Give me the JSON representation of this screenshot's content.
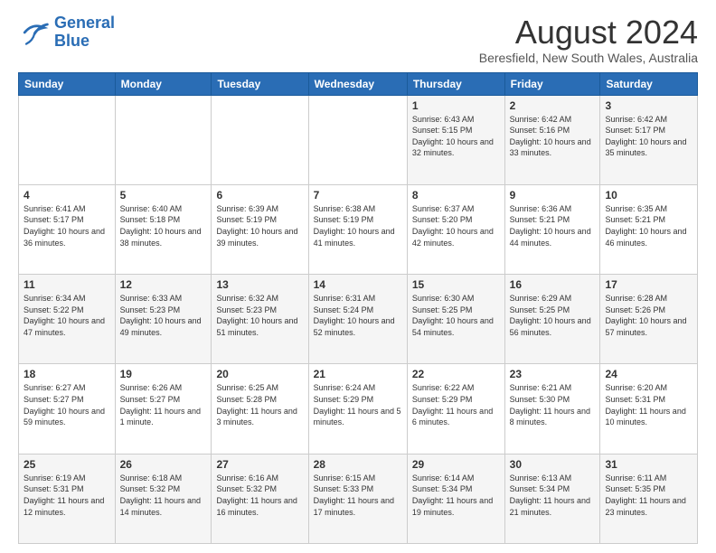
{
  "logo": {
    "line1": "General",
    "line2": "Blue"
  },
  "calendar": {
    "title": "August 2024",
    "subtitle": "Beresfield, New South Wales, Australia"
  },
  "weekdays": [
    "Sunday",
    "Monday",
    "Tuesday",
    "Wednesday",
    "Thursday",
    "Friday",
    "Saturday"
  ],
  "weeks": [
    [
      {
        "day": "",
        "info": ""
      },
      {
        "day": "",
        "info": ""
      },
      {
        "day": "",
        "info": ""
      },
      {
        "day": "",
        "info": ""
      },
      {
        "day": "1",
        "info": "Sunrise: 6:43 AM\nSunset: 5:15 PM\nDaylight: 10 hours\nand 32 minutes."
      },
      {
        "day": "2",
        "info": "Sunrise: 6:42 AM\nSunset: 5:16 PM\nDaylight: 10 hours\nand 33 minutes."
      },
      {
        "day": "3",
        "info": "Sunrise: 6:42 AM\nSunset: 5:17 PM\nDaylight: 10 hours\nand 35 minutes."
      }
    ],
    [
      {
        "day": "4",
        "info": "Sunrise: 6:41 AM\nSunset: 5:17 PM\nDaylight: 10 hours\nand 36 minutes."
      },
      {
        "day": "5",
        "info": "Sunrise: 6:40 AM\nSunset: 5:18 PM\nDaylight: 10 hours\nand 38 minutes."
      },
      {
        "day": "6",
        "info": "Sunrise: 6:39 AM\nSunset: 5:19 PM\nDaylight: 10 hours\nand 39 minutes."
      },
      {
        "day": "7",
        "info": "Sunrise: 6:38 AM\nSunset: 5:19 PM\nDaylight: 10 hours\nand 41 minutes."
      },
      {
        "day": "8",
        "info": "Sunrise: 6:37 AM\nSunset: 5:20 PM\nDaylight: 10 hours\nand 42 minutes."
      },
      {
        "day": "9",
        "info": "Sunrise: 6:36 AM\nSunset: 5:21 PM\nDaylight: 10 hours\nand 44 minutes."
      },
      {
        "day": "10",
        "info": "Sunrise: 6:35 AM\nSunset: 5:21 PM\nDaylight: 10 hours\nand 46 minutes."
      }
    ],
    [
      {
        "day": "11",
        "info": "Sunrise: 6:34 AM\nSunset: 5:22 PM\nDaylight: 10 hours\nand 47 minutes."
      },
      {
        "day": "12",
        "info": "Sunrise: 6:33 AM\nSunset: 5:23 PM\nDaylight: 10 hours\nand 49 minutes."
      },
      {
        "day": "13",
        "info": "Sunrise: 6:32 AM\nSunset: 5:23 PM\nDaylight: 10 hours\nand 51 minutes."
      },
      {
        "day": "14",
        "info": "Sunrise: 6:31 AM\nSunset: 5:24 PM\nDaylight: 10 hours\nand 52 minutes."
      },
      {
        "day": "15",
        "info": "Sunrise: 6:30 AM\nSunset: 5:25 PM\nDaylight: 10 hours\nand 54 minutes."
      },
      {
        "day": "16",
        "info": "Sunrise: 6:29 AM\nSunset: 5:25 PM\nDaylight: 10 hours\nand 56 minutes."
      },
      {
        "day": "17",
        "info": "Sunrise: 6:28 AM\nSunset: 5:26 PM\nDaylight: 10 hours\nand 57 minutes."
      }
    ],
    [
      {
        "day": "18",
        "info": "Sunrise: 6:27 AM\nSunset: 5:27 PM\nDaylight: 10 hours\nand 59 minutes."
      },
      {
        "day": "19",
        "info": "Sunrise: 6:26 AM\nSunset: 5:27 PM\nDaylight: 11 hours\nand 1 minute."
      },
      {
        "day": "20",
        "info": "Sunrise: 6:25 AM\nSunset: 5:28 PM\nDaylight: 11 hours\nand 3 minutes."
      },
      {
        "day": "21",
        "info": "Sunrise: 6:24 AM\nSunset: 5:29 PM\nDaylight: 11 hours\nand 5 minutes."
      },
      {
        "day": "22",
        "info": "Sunrise: 6:22 AM\nSunset: 5:29 PM\nDaylight: 11 hours\nand 6 minutes."
      },
      {
        "day": "23",
        "info": "Sunrise: 6:21 AM\nSunset: 5:30 PM\nDaylight: 11 hours\nand 8 minutes."
      },
      {
        "day": "24",
        "info": "Sunrise: 6:20 AM\nSunset: 5:31 PM\nDaylight: 11 hours\nand 10 minutes."
      }
    ],
    [
      {
        "day": "25",
        "info": "Sunrise: 6:19 AM\nSunset: 5:31 PM\nDaylight: 11 hours\nand 12 minutes."
      },
      {
        "day": "26",
        "info": "Sunrise: 6:18 AM\nSunset: 5:32 PM\nDaylight: 11 hours\nand 14 minutes."
      },
      {
        "day": "27",
        "info": "Sunrise: 6:16 AM\nSunset: 5:32 PM\nDaylight: 11 hours\nand 16 minutes."
      },
      {
        "day": "28",
        "info": "Sunrise: 6:15 AM\nSunset: 5:33 PM\nDaylight: 11 hours\nand 17 minutes."
      },
      {
        "day": "29",
        "info": "Sunrise: 6:14 AM\nSunset: 5:34 PM\nDaylight: 11 hours\nand 19 minutes."
      },
      {
        "day": "30",
        "info": "Sunrise: 6:13 AM\nSunset: 5:34 PM\nDaylight: 11 hours\nand 21 minutes."
      },
      {
        "day": "31",
        "info": "Sunrise: 6:11 AM\nSunset: 5:35 PM\nDaylight: 11 hours\nand 23 minutes."
      }
    ]
  ]
}
